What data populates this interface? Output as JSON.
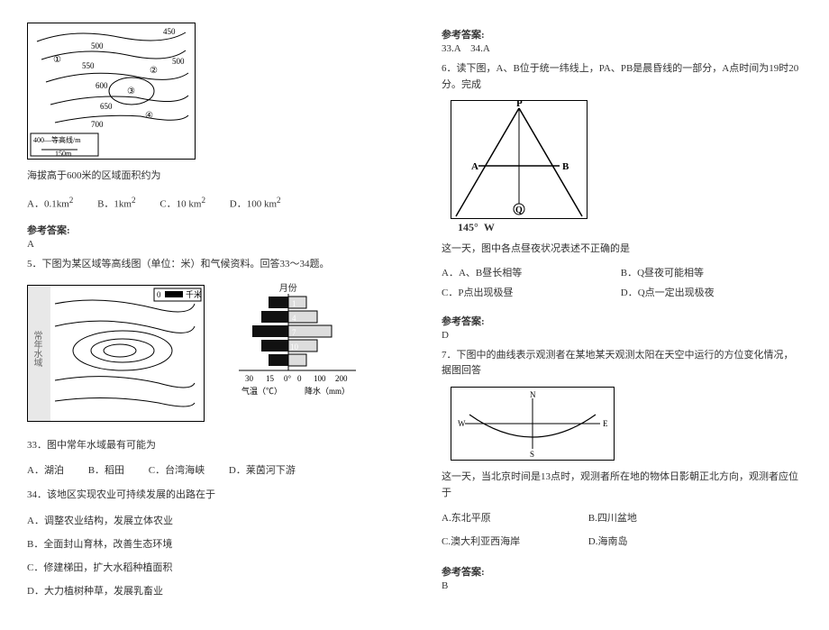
{
  "left": {
    "topomap": {
      "contours": [
        "450",
        "500",
        "550",
        "500",
        "600",
        "650",
        "700"
      ],
      "legend_line1": "400—等高线/m",
      "legend_line2": "150m",
      "points": [
        "①",
        "②",
        "③",
        "④"
      ]
    },
    "q_area": {
      "stem": "海拔高于600米的区域面积约为",
      "opts": {
        "A": "A．0.1km",
        "B": "B．1km",
        "C": "C．10 km",
        "D": "D．100 km"
      },
      "sq": "2"
    },
    "ans1_hdr": "参考答案:",
    "ans1": "A",
    "q5_intro": "5．下图为某区域等高线图（单位：米）和气候资料。回答33～34题。",
    "contour": {
      "side_label": "常年水域",
      "scale_num": "0",
      "scale_unit": "千米"
    },
    "climate": {
      "title": "月份",
      "months": [
        "1",
        "4",
        "7",
        "10"
      ],
      "x_ticks_temp": [
        "30",
        "15",
        "0°",
        "0"
      ],
      "x_ticks_prec": [
        "100",
        "200"
      ],
      "x_label_temp": "气温（℃）",
      "x_label_prec": "降水（mm）"
    },
    "q33": {
      "stem": "33．图中常年水域最有可能为",
      "opts": {
        "A": "A．湖泊",
        "B": "B．稻田",
        "C": "C．台湾海峡",
        "D": "D．莱茵河下游"
      }
    },
    "q34": {
      "stem": "34．该地区实现农业可持续发展的出路在于",
      "opts": {
        "A": "A．调整农业结构，发展立体农业",
        "B": "B．全面封山育林，改善生态环境",
        "C": "C．修建梯田，扩大水稻种植面积",
        "D": "D．大力植树种草，发展乳畜业"
      }
    }
  },
  "right": {
    "ans33_hdr": "参考答案:",
    "ans33": "33.A    34.A",
    "q6_intro": "6．读下图，A、B位于统一纬线上，PA、PB是晨昏线的一部分，A点时间为19时20分。完成",
    "diagram": {
      "labels": {
        "P": "P",
        "A": "A",
        "B": "B",
        "Q": "Q",
        "deg": "145°",
        "W": "W"
      }
    },
    "q6_stem": "这一天，图中各点昼夜状况表述不正确的是",
    "q6_opts": {
      "A": "A．A、B昼长相等",
      "B": "B．Q昼夜可能相等",
      "C": "C．P点出现极昼",
      "D": "D．Q点一定出现极夜"
    },
    "ans6_hdr": "参考答案:",
    "ans6": "D",
    "q7_intro": "7．下图中的曲线表示观测者在某地某天观测太阳在天空中运行的方位变化情况，据图回答",
    "compass": {
      "N": "N",
      "S": "S",
      "W": "W",
      "E": "E"
    },
    "q7_stem": "这一天，当北京时间是13点时，观测者所在地的物体日影朝正北方向，观测者应位于",
    "q7_opts": {
      "A": "A.东北平原",
      "B": "B.四川盆地",
      "C": "C.澳大利亚西海岸",
      "D": "D.海南岛"
    },
    "ans7_hdr": "参考答案:",
    "ans7": "B"
  }
}
